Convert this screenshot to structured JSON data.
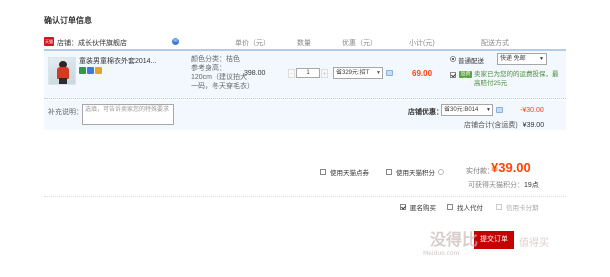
{
  "page": {
    "title": "确认订单信息"
  },
  "headers": {
    "shop_prefix": "店铺：",
    "shop_name": "成长伙伴旗舰店",
    "shop_icon_text": "天猫",
    "unit_price": "单价（元）",
    "quantity": "数量",
    "discount": "优惠（元）",
    "subtotal": "小计(元)",
    "delivery": "配送方式"
  },
  "item": {
    "name": "童装男童棉衣外套2014...",
    "color_label": "颜色分类：桔色",
    "height_label": "参考身高：",
    "height_value": "120cm（建议拍大一码，冬天穿毛衣）",
    "price": "398.00",
    "quantity": "1",
    "qty_minus": "-",
    "qty_plus": "+",
    "coupon": "省329元:招T",
    "subtotal": "69.00",
    "service_icon_colors": [
      "#2e9a4a",
      "#3b7bd9",
      "#e0a81c"
    ]
  },
  "delivery": {
    "standard": "普通配送",
    "option": "快递 免邮",
    "insurance_tag": "运费险",
    "insurance_text": "卖家已为您的的运费投保，最高赔付25元"
  },
  "memo": {
    "label": "补充说明：",
    "placeholder": "选填，可告诉卖家您的特殊要求"
  },
  "shop_coupon": {
    "label": "店铺优惠：",
    "select": "省30元:B014",
    "amount": "-¥30.00",
    "total_label": "店铺合计(含运费)",
    "total_value": "¥39.00"
  },
  "options": {
    "tmall_coupon": "使用天猫点券",
    "tmall_points": "使用天猫积分"
  },
  "payment": {
    "label": "实付款：",
    "amount": "¥39.00",
    "points_label": "可获得天猫积分：",
    "points_value": "19点"
  },
  "bottom_options": {
    "anonymous": "匿名购买",
    "proxy": "找人代付",
    "credit_card": "信用卡分期"
  },
  "submit": {
    "label": "提交订单"
  },
  "watermark": {
    "logo": "没得比",
    "url": "Meiduo.com",
    "right": "值得买"
  }
}
